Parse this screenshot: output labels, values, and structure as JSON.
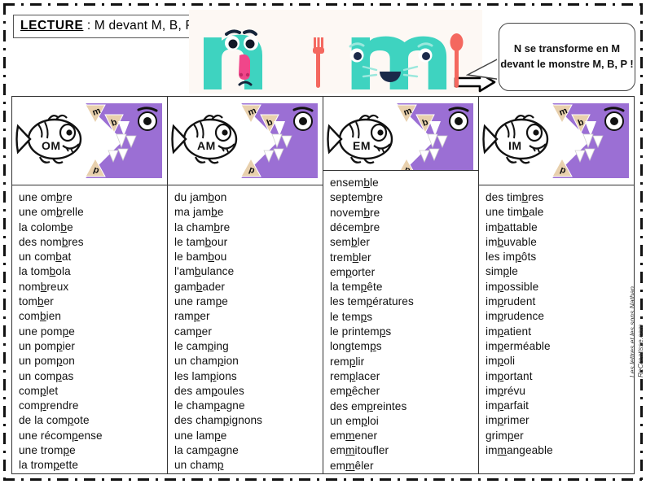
{
  "header": {
    "title_label": "LECTURE",
    "title_rest": " : M devant M, B, P",
    "speech_bubble": "N se transforme en M devant le monstre M, B, P !",
    "letter_n": "n",
    "letter_m": "m",
    "arrow_icon": "right-arrow-icon"
  },
  "credit": {
    "source": "Les lettres et les sons Nathan",
    "site": "ReCreatisse.com"
  },
  "colors": {
    "letter_teal": "#3ed3c0",
    "monster_purple": "#9b6fd4",
    "tooth_tan": "#e8d0ad",
    "nose_pink": "#f0468a",
    "utensil_coral": "#f4685f",
    "border_dark": "#333333"
  },
  "monster_teeth": [
    "m",
    "b",
    "p"
  ],
  "columns": [
    {
      "fish_label": "OM",
      "words": [
        [
          [
            "une o"
          ],
          [
            "m"
          ],
          [
            "b",
            true
          ],
          [
            "re"
          ]
        ],
        [
          [
            "une o"
          ],
          [
            "m"
          ],
          [
            "b",
            true
          ],
          [
            "relle"
          ]
        ],
        [
          [
            "la colo"
          ],
          [
            "m"
          ],
          [
            "b",
            true
          ],
          [
            "e"
          ]
        ],
        [
          [
            "des no"
          ],
          [
            "m"
          ],
          [
            "b",
            true
          ],
          [
            "res"
          ]
        ],
        [
          [
            "un co"
          ],
          [
            "m"
          ],
          [
            "b",
            true
          ],
          [
            "at"
          ]
        ],
        [
          [
            "la to"
          ],
          [
            "m"
          ],
          [
            "b",
            true
          ],
          [
            "ola"
          ]
        ],
        [
          [
            "no"
          ],
          [
            "m"
          ],
          [
            "b",
            true
          ],
          [
            "reux"
          ]
        ],
        [
          [
            "to"
          ],
          [
            "m"
          ],
          [
            "b",
            true
          ],
          [
            "er"
          ]
        ],
        [
          [
            "co"
          ],
          [
            "m"
          ],
          [
            "b",
            true
          ],
          [
            "ien"
          ]
        ],
        [
          [
            "une po"
          ],
          [
            "m"
          ],
          [
            "p",
            true
          ],
          [
            "e"
          ]
        ],
        [
          [
            "un po"
          ],
          [
            "m"
          ],
          [
            "p",
            true
          ],
          [
            "ier"
          ]
        ],
        [
          [
            "un po"
          ],
          [
            "m"
          ],
          [
            "p",
            true
          ],
          [
            "on"
          ]
        ],
        [
          [
            "un co"
          ],
          [
            "m"
          ],
          [
            "p",
            true
          ],
          [
            "as"
          ]
        ],
        [
          [
            "co"
          ],
          [
            "m"
          ],
          [
            "p",
            true
          ],
          [
            "let"
          ]
        ],
        [
          [
            "co"
          ],
          [
            "m"
          ],
          [
            "p",
            true
          ],
          [
            "rendre"
          ]
        ],
        [
          [
            "de la co"
          ],
          [
            "m"
          ],
          [
            "p",
            true
          ],
          [
            "ote"
          ]
        ],
        [
          [
            "une réco"
          ],
          [
            "m"
          ],
          [
            "p",
            true
          ],
          [
            "ense"
          ]
        ],
        [
          [
            "une tro"
          ],
          [
            "m"
          ],
          [
            "p",
            true
          ],
          [
            "e"
          ]
        ],
        [
          [
            "la tro"
          ],
          [
            "m"
          ],
          [
            "p",
            true
          ],
          [
            "ette"
          ]
        ]
      ]
    },
    {
      "fish_label": "AM",
      "words": [
        [
          [
            "du ja"
          ],
          [
            "m"
          ],
          [
            "b",
            true
          ],
          [
            "on"
          ]
        ],
        [
          [
            "ma ja"
          ],
          [
            "m"
          ],
          [
            "b",
            true
          ],
          [
            "e"
          ]
        ],
        [
          [
            "la cha"
          ],
          [
            "m"
          ],
          [
            "b",
            true
          ],
          [
            "re"
          ]
        ],
        [
          [
            "le ta"
          ],
          [
            "m"
          ],
          [
            "b",
            true
          ],
          [
            "our"
          ]
        ],
        [
          [
            "le ba"
          ],
          [
            "m"
          ],
          [
            "b",
            true
          ],
          [
            "ou"
          ]
        ],
        [
          [
            "l'a"
          ],
          [
            "m"
          ],
          [
            "b",
            true
          ],
          [
            "ulance"
          ]
        ],
        [
          [
            "ga"
          ],
          [
            "m"
          ],
          [
            "b",
            true
          ],
          [
            "ader"
          ]
        ],
        [
          [
            "une ra"
          ],
          [
            "m"
          ],
          [
            "p",
            true
          ],
          [
            "e"
          ]
        ],
        [
          [
            "ra"
          ],
          [
            "m"
          ],
          [
            "p",
            true
          ],
          [
            "er"
          ]
        ],
        [
          [
            "ca"
          ],
          [
            "m"
          ],
          [
            "p",
            true
          ],
          [
            "er"
          ]
        ],
        [
          [
            "le ca"
          ],
          [
            "m"
          ],
          [
            "p",
            true
          ],
          [
            "ing"
          ]
        ],
        [
          [
            "un cha"
          ],
          [
            "m"
          ],
          [
            "p",
            true
          ],
          [
            "ion"
          ]
        ],
        [
          [
            "les la"
          ],
          [
            "m"
          ],
          [
            "p",
            true
          ],
          [
            "ions"
          ]
        ],
        [
          [
            "des a"
          ],
          [
            "m"
          ],
          [
            "p",
            true
          ],
          [
            "oules"
          ]
        ],
        [
          [
            "le cha"
          ],
          [
            "m"
          ],
          [
            "p",
            true
          ],
          [
            "agne"
          ]
        ],
        [
          [
            "des cha"
          ],
          [
            "m"
          ],
          [
            "p",
            true
          ],
          [
            "ignons"
          ]
        ],
        [
          [
            "une la"
          ],
          [
            "m"
          ],
          [
            "p",
            true
          ],
          [
            "e"
          ]
        ],
        [
          [
            "la ca"
          ],
          [
            "m"
          ],
          [
            "p",
            true
          ],
          [
            "agne"
          ]
        ],
        [
          [
            "un cha"
          ],
          [
            "m"
          ],
          [
            "p",
            true
          ],
          [
            ""
          ]
        ]
      ]
    },
    {
      "fish_label": "EM",
      "words": [
        [
          [
            "ense"
          ],
          [
            "m"
          ],
          [
            "b",
            true
          ],
          [
            "le"
          ]
        ],
        [
          [
            "septe"
          ],
          [
            "m"
          ],
          [
            "b",
            true
          ],
          [
            "re"
          ]
        ],
        [
          [
            "nove"
          ],
          [
            "m"
          ],
          [
            "b",
            true
          ],
          [
            "re"
          ]
        ],
        [
          [
            "déce"
          ],
          [
            "m"
          ],
          [
            "b",
            true
          ],
          [
            "re"
          ]
        ],
        [
          [
            "se"
          ],
          [
            "m"
          ],
          [
            "b",
            true
          ],
          [
            "ler"
          ]
        ],
        [
          [
            "tre"
          ],
          [
            "m"
          ],
          [
            "b",
            true
          ],
          [
            "ler"
          ]
        ],
        [
          [
            "e"
          ],
          [
            "m"
          ],
          [
            "p",
            true
          ],
          [
            "orter"
          ]
        ],
        [
          [
            "la te"
          ],
          [
            "m"
          ],
          [
            "p",
            true
          ],
          [
            "ête"
          ]
        ],
        [
          [
            "les te"
          ],
          [
            "m"
          ],
          [
            "p",
            true
          ],
          [
            "ératures"
          ]
        ],
        [
          [
            "le te"
          ],
          [
            "m"
          ],
          [
            "p",
            true
          ],
          [
            "s"
          ]
        ],
        [
          [
            "le printe"
          ],
          [
            "m"
          ],
          [
            "p",
            true
          ],
          [
            "s"
          ]
        ],
        [
          [
            "longte"
          ],
          [
            "m"
          ],
          [
            "p",
            true
          ],
          [
            "s"
          ]
        ],
        [
          [
            "re"
          ],
          [
            "m"
          ],
          [
            "p",
            true
          ],
          [
            "lir"
          ]
        ],
        [
          [
            "re"
          ],
          [
            "m"
          ],
          [
            "p",
            true
          ],
          [
            "lacer"
          ]
        ],
        [
          [
            "e"
          ],
          [
            "m"
          ],
          [
            "p",
            true
          ],
          [
            "êcher"
          ]
        ],
        [
          [
            "des e"
          ],
          [
            "m"
          ],
          [
            "p",
            true
          ],
          [
            "reintes"
          ]
        ],
        [
          [
            "un e"
          ],
          [
            "m"
          ],
          [
            "p",
            true
          ],
          [
            "loi"
          ]
        ],
        [
          [
            "e"
          ],
          [
            "m"
          ],
          [
            "m",
            true
          ],
          [
            "ener"
          ]
        ],
        [
          [
            "e"
          ],
          [
            "m"
          ],
          [
            "m",
            true
          ],
          [
            "itoufler"
          ]
        ],
        [
          [
            "e"
          ],
          [
            "m"
          ],
          [
            "m",
            true
          ],
          [
            "êler"
          ]
        ]
      ]
    },
    {
      "fish_label": "IM",
      "words": [
        [
          [
            "des ti"
          ],
          [
            "m"
          ],
          [
            "b",
            true
          ],
          [
            "res"
          ]
        ],
        [
          [
            "une ti"
          ],
          [
            "m"
          ],
          [
            "b",
            true
          ],
          [
            "ale"
          ]
        ],
        [
          [
            "i"
          ],
          [
            "m"
          ],
          [
            "b",
            true
          ],
          [
            "attable"
          ]
        ],
        [
          [
            "i"
          ],
          [
            "m"
          ],
          [
            "b",
            true
          ],
          [
            "uvable"
          ]
        ],
        [
          [
            "les i"
          ],
          [
            "m"
          ],
          [
            "p",
            true
          ],
          [
            "ôts"
          ]
        ],
        [
          [
            "si"
          ],
          [
            "m"
          ],
          [
            "p",
            true
          ],
          [
            "le"
          ]
        ],
        [
          [
            "i"
          ],
          [
            "m"
          ],
          [
            "p",
            true
          ],
          [
            "ossible"
          ]
        ],
        [
          [
            "i"
          ],
          [
            "m"
          ],
          [
            "p",
            true
          ],
          [
            "rudent"
          ]
        ],
        [
          [
            "i"
          ],
          [
            "m"
          ],
          [
            "p",
            true
          ],
          [
            "rudence"
          ]
        ],
        [
          [
            "i"
          ],
          [
            "m"
          ],
          [
            "p",
            true
          ],
          [
            "atient"
          ]
        ],
        [
          [
            "i"
          ],
          [
            "m"
          ],
          [
            "p",
            true
          ],
          [
            "erméable"
          ]
        ],
        [
          [
            "i"
          ],
          [
            "m"
          ],
          [
            "p",
            true
          ],
          [
            "oli"
          ]
        ],
        [
          [
            "i"
          ],
          [
            "m"
          ],
          [
            "p",
            true
          ],
          [
            "ortant"
          ]
        ],
        [
          [
            "i"
          ],
          [
            "m"
          ],
          [
            "p",
            true
          ],
          [
            "révu"
          ]
        ],
        [
          [
            "i"
          ],
          [
            "m"
          ],
          [
            "p",
            true
          ],
          [
            "arfait"
          ]
        ],
        [
          [
            "i"
          ],
          [
            "m"
          ],
          [
            "p",
            true
          ],
          [
            "rimer"
          ]
        ],
        [
          [
            "gri"
          ],
          [
            "m"
          ],
          [
            "p",
            true
          ],
          [
            "er"
          ]
        ],
        [
          [
            "i"
          ],
          [
            "m"
          ],
          [
            "m",
            true
          ],
          [
            "angeable"
          ]
        ]
      ]
    }
  ]
}
